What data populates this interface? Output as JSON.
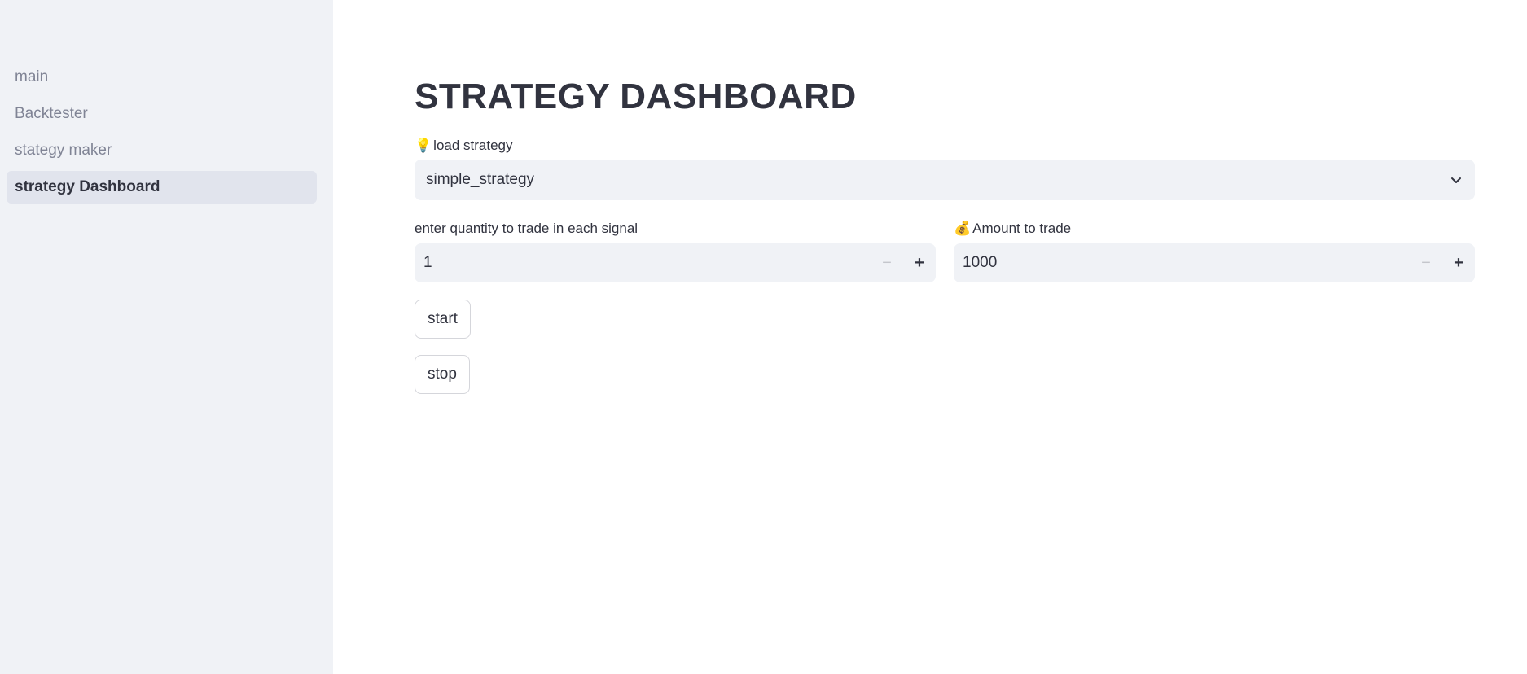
{
  "sidebar": {
    "items": [
      {
        "label": "main",
        "active": false
      },
      {
        "label": "Backtester",
        "active": false
      },
      {
        "label": "stategy maker",
        "active": false
      },
      {
        "label": "strategy Dashboard",
        "active": true
      }
    ]
  },
  "main": {
    "title": "STRATEGY DASHBOARD",
    "load_strategy": {
      "emoji": "💡",
      "label": "load strategy",
      "selected": "simple_strategy",
      "icon": "chevron-down-icon"
    },
    "quantity": {
      "label": "enter quantity to trade in each signal",
      "value": "1",
      "minus": "−",
      "plus": "+"
    },
    "amount": {
      "emoji": "💰",
      "label": "Amount to trade",
      "value": "1000",
      "minus": "−",
      "plus": "+"
    },
    "start_label": "start",
    "stop_label": "stop"
  },
  "colors": {
    "sidebar_bg": "#f0f2f6",
    "active_item_bg": "#e1e4ed",
    "input_bg": "#f0f2f6",
    "text": "#31333f",
    "muted_text": "#808495"
  }
}
